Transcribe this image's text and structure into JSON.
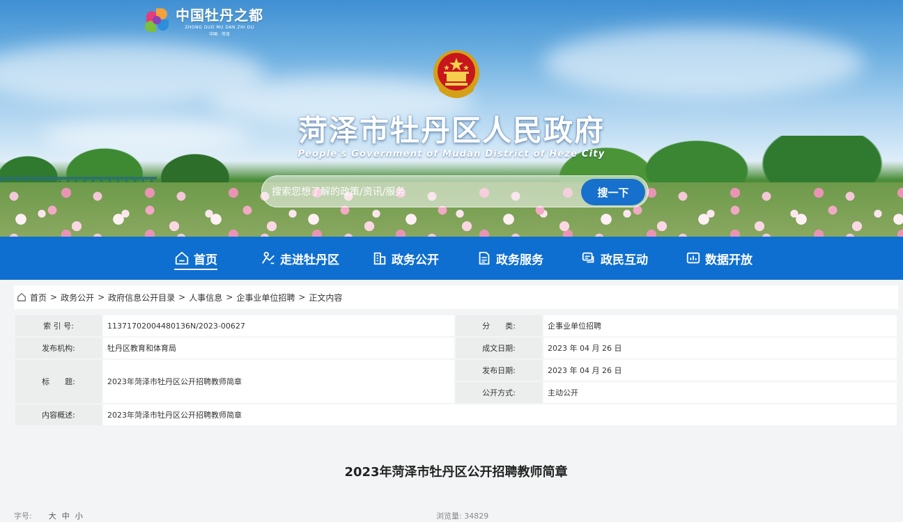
{
  "logo": {
    "title": "中国牡丹之都",
    "subtitle": "ZHONG GUO MU DAN ZHI DU",
    "caption": "中国 · 菏泽"
  },
  "site": {
    "title": "菏泽市牡丹区人民政府",
    "subtitle": "People's Government of Mudan District of Heze City"
  },
  "search": {
    "placeholder": "搜索您想了解的政策/资讯/服务",
    "button_label": "搜一下"
  },
  "nav": {
    "items": [
      {
        "label": "首页",
        "icon": "home-icon",
        "active": true
      },
      {
        "label": "走进牡丹区",
        "icon": "intro-icon"
      },
      {
        "label": "政务公开",
        "icon": "building-icon"
      },
      {
        "label": "政务服务",
        "icon": "document-icon"
      },
      {
        "label": "政民互动",
        "icon": "chat-icon"
      },
      {
        "label": "数据开放",
        "icon": "chart-icon"
      }
    ]
  },
  "breadcrumb": {
    "items": [
      "首页",
      "政务公开",
      "政府信息公开目录",
      "人事信息",
      "企事业单位招聘",
      "正文内容"
    ],
    "separator": ">"
  },
  "info": {
    "index_label": "索 引 号:",
    "index_value": "11371702004480136N/2023-00627",
    "category_label": "分　　类:",
    "category_value": "企事业单位招聘",
    "publisher_label": "发布机构:",
    "publisher_value": "牡丹区教育和体育局",
    "written_date_label": "成文日期:",
    "written_date_value": "2023 年 04 月 26 日",
    "title_label": "标　　题:",
    "title_value": "2023年菏泽市牡丹区公开招聘教师简章",
    "publish_date_label": "发布日期:",
    "publish_date_value": "2023 年 04 月 26 日",
    "open_mode_label": "公开方式:",
    "open_mode_value": "主动公开",
    "summary_label": "内容概述:",
    "summary_value": "2023年菏泽市牡丹区公开招聘教师简章"
  },
  "article": {
    "title": "2023年菏泽市牡丹区公开招聘教师简章"
  },
  "meta": {
    "font_size_label": "字号:",
    "size_large": "大",
    "size_medium": "中",
    "size_small": "小",
    "views_label": "浏览量:",
    "views_value": "34829"
  },
  "colors": {
    "nav_bg": "#0f6fd0",
    "button_bg": "#1670cc",
    "page_bg": "#f3f4f5"
  }
}
